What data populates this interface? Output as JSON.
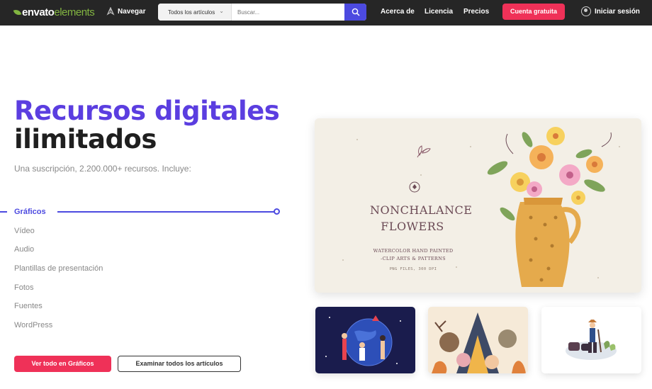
{
  "header": {
    "logo_bold": "envato",
    "logo_light": "elements",
    "browse_label": "Navegar",
    "search": {
      "category_selected": "Todos los artículos",
      "placeholder": "Buscar..."
    },
    "links": [
      "Acerca de",
      "Licencia",
      "Precios"
    ],
    "cta_label": "Cuenta gratuita",
    "signin_label": "Iniciar sesión"
  },
  "hero": {
    "title_accent": "Recursos digitales",
    "title_dark": "ilimitados",
    "subtitle": "Una suscripción, 2.200.000+ recursos. Incluye:",
    "categories": [
      "Gráficos",
      "Vídeo",
      "Audio",
      "Plantillas de presentación",
      "Fotos",
      "Fuentes",
      "WordPress"
    ],
    "active_category": "Gráficos",
    "primary_button": "Ver todo en Gráficos",
    "secondary_button": "Examinar todos los artículos"
  },
  "featured": {
    "title_line1": "NONCHALANCE",
    "title_line2": "FLOWERS",
    "sub_line1": "WATERCOLOR HAND PAINTED",
    "sub_line2": "-CLIP ARTS & PATTERNS",
    "files": "PNG FILES, 300 DPI"
  },
  "colors": {
    "accent": "#5b3ee0",
    "cta": "#ef3158",
    "topbar": "#262626",
    "logo_green": "#82b541"
  }
}
